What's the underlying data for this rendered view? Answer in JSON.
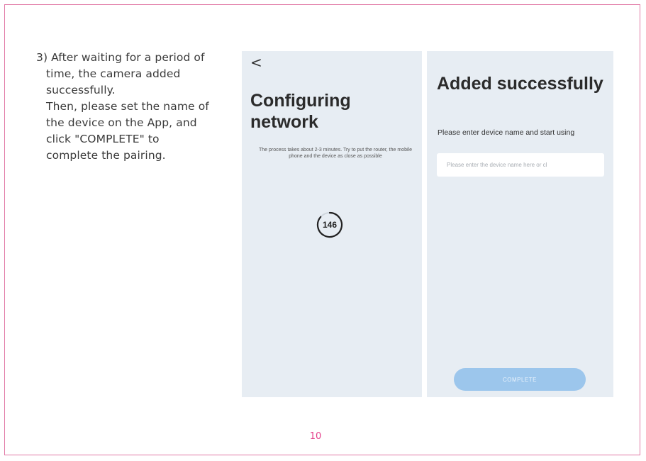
{
  "instruction": {
    "lines": [
      "3) After waiting for a period of",
      "time, the camera added",
      "successfully.",
      "Then,  please set the name of",
      "the device on the App, and",
      "click \"COMPLETE\" to",
      "complete the pairing."
    ]
  },
  "configuring_screen": {
    "back_icon": "chevron-left-icon",
    "back_glyph": "<",
    "title": "Configuring network",
    "process_text": "The process takes about 2-3 minutes. Try to put the router, the mobile phone and the device as close as possible",
    "countdown": "146"
  },
  "added_screen": {
    "title": "Added successfully",
    "prompt": "Please enter device name and start using",
    "name_input_placeholder": "Please enter the device name here or cl",
    "name_input_value": "",
    "complete_label": "COMPLETE"
  },
  "footer": {
    "page_number": "10"
  },
  "colors": {
    "frame_border": "#e17aa6",
    "page_number": "#e4418b",
    "phone_background": "#e7edf3",
    "complete_button": "#9cc6ec"
  }
}
